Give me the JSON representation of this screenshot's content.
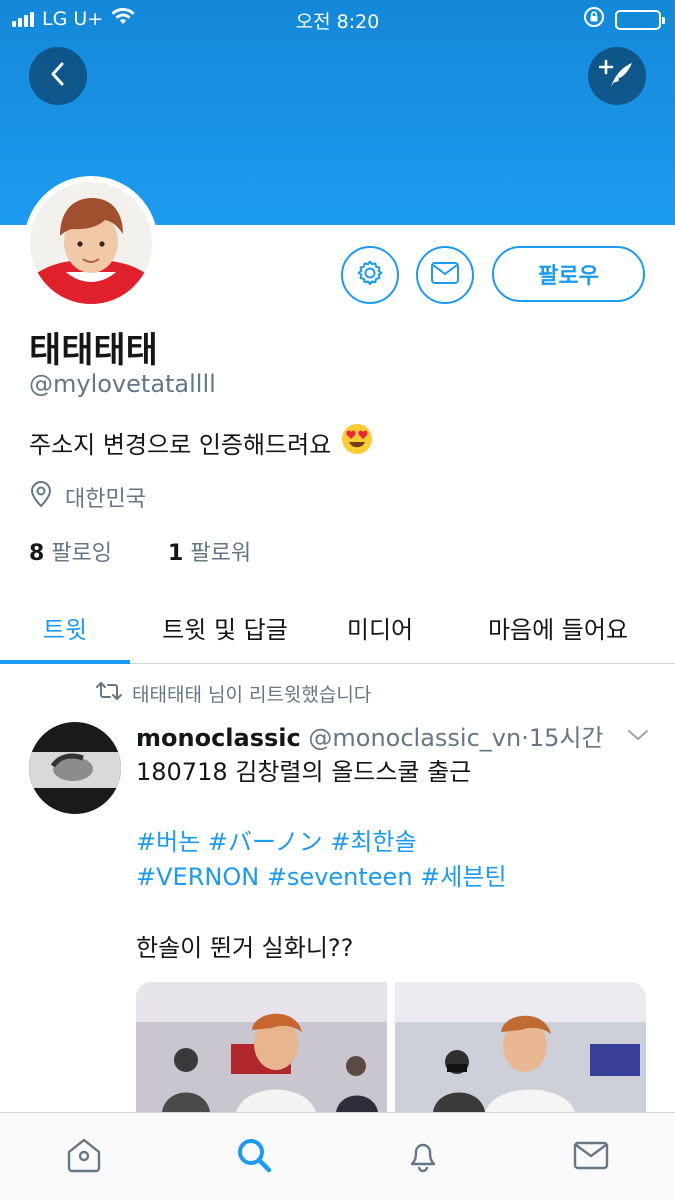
{
  "status_bar": {
    "carrier": "LG U+",
    "time": "오전 8:20"
  },
  "profile": {
    "display_name": "태태태태",
    "handle": "@mylovetatallll",
    "bio": "주소지 변경으로 인증해드려요",
    "location": "대한민국",
    "following_count": "8",
    "following_label": "팔로잉",
    "followers_count": "1",
    "followers_label": "팔로워",
    "follow_button_label": "팔로우"
  },
  "tabs": [
    {
      "label": "트윗",
      "active": true
    },
    {
      "label": "트윗 및 답글",
      "active": false
    },
    {
      "label": "미디어",
      "active": false
    },
    {
      "label": "마음에 들어요",
      "active": false
    }
  ],
  "tweet": {
    "retweet_notice": "태태태태 님이 리트윗했습니다",
    "author_name": "monoclassic",
    "author_handle": "@monoclassic_vn",
    "separator": "·",
    "time_ago": "15시간",
    "line1": "180718 김창렬의 올드스쿨 출근",
    "hashtags_line1": [
      "#버논",
      "#バーノン",
      "#최한솔"
    ],
    "hashtags_line2": [
      "#VERNON",
      "#seventeen",
      "#세븐틴"
    ],
    "line_last": "한솔이 뛴거 실화니??"
  },
  "icons": {
    "back": "chevron-left-icon",
    "compose": "compose-tweet-icon",
    "settings": "gear-icon",
    "message": "envelope-icon",
    "location": "location-pin-icon",
    "retweet": "retweet-icon",
    "more": "chevron-down-icon",
    "nav": [
      "home-icon",
      "search-icon",
      "bell-icon",
      "envelope-icon"
    ]
  },
  "colors": {
    "accent": "#1d9bf0",
    "secondary_text": "#657786",
    "header": "#1488d8"
  }
}
